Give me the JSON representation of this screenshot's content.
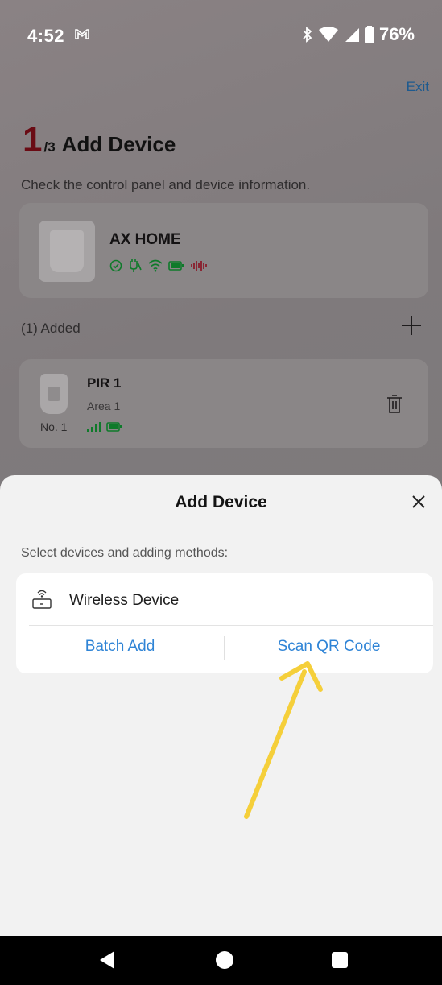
{
  "status_bar": {
    "time": "4:52",
    "battery": "76%"
  },
  "header": {
    "exit_label": "Exit",
    "step_current": "1",
    "step_total": "/3",
    "title": "Add Device",
    "subtitle": "Check the control panel and device information."
  },
  "control_panel": {
    "name": "AX HOME"
  },
  "added": {
    "label": "(1) Added",
    "devices": [
      {
        "no": "No. 1",
        "name": "PIR 1",
        "area": "Area 1"
      }
    ]
  },
  "sheet": {
    "title": "Add Device",
    "hint": "Select devices and adding methods:",
    "device_type": "Wireless Device",
    "batch_add": "Batch Add",
    "scan_qr": "Scan QR Code"
  },
  "colors": {
    "accent": "#2f84d6",
    "step_red": "#6a0b14",
    "status_green": "#0e7a2a",
    "alarm_red": "#8a1020",
    "annotation_yellow": "#f5cf3a"
  }
}
